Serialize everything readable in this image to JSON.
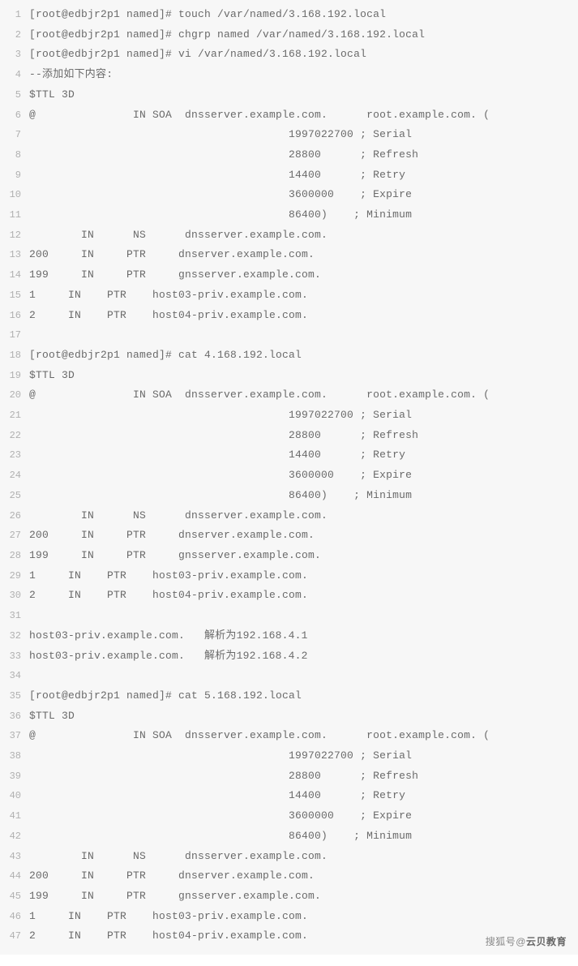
{
  "lines": [
    "[root@edbjr2p1 named]# touch /var/named/3.168.192.local",
    "[root@edbjr2p1 named]# chgrp named /var/named/3.168.192.local",
    "[root@edbjr2p1 named]# vi /var/named/3.168.192.local",
    "--添加如下内容:",
    "$TTL 3D",
    "@               IN SOA  dnsserver.example.com.      root.example.com. (",
    "                                        1997022700 ; Serial",
    "                                        28800      ; Refresh",
    "                                        14400      ; Retry",
    "                                        3600000    ; Expire",
    "                                        86400)    ; Minimum",
    "        IN      NS      dnsserver.example.com.",
    "200     IN     PTR     dnserver.example.com.",
    "199     IN     PTR     gnsserver.example.com.",
    "1     IN    PTR    host03-priv.example.com.",
    "2     IN    PTR    host04-priv.example.com.",
    "",
    "[root@edbjr2p1 named]# cat 4.168.192.local",
    "$TTL 3D",
    "@               IN SOA  dnsserver.example.com.      root.example.com. (",
    "                                        1997022700 ; Serial",
    "                                        28800      ; Refresh",
    "                                        14400      ; Retry",
    "                                        3600000    ; Expire",
    "                                        86400)    ; Minimum",
    "        IN      NS      dnsserver.example.com.",
    "200     IN     PTR     dnserver.example.com.",
    "199     IN     PTR     gnsserver.example.com.",
    "1     IN    PTR    host03-priv.example.com.",
    "2     IN    PTR    host04-priv.example.com.",
    "",
    "host03-priv.example.com.   解析为192.168.4.1",
    "host03-priv.example.com.   解析为192.168.4.2",
    "",
    "[root@edbjr2p1 named]# cat 5.168.192.local",
    "$TTL 3D",
    "@               IN SOA  dnsserver.example.com.      root.example.com. (",
    "                                        1997022700 ; Serial",
    "                                        28800      ; Refresh",
    "                                        14400      ; Retry",
    "                                        3600000    ; Expire",
    "                                        86400)    ; Minimum",
    "        IN      NS      dnsserver.example.com.",
    "200     IN     PTR     dnserver.example.com.",
    "199     IN     PTR     gnsserver.example.com.",
    "1     IN    PTR    host03-priv.example.com.",
    "2     IN    PTR    host04-priv.example.com."
  ],
  "watermark": {
    "prefix": "搜狐号",
    "at": "@",
    "name": "云贝教育"
  }
}
